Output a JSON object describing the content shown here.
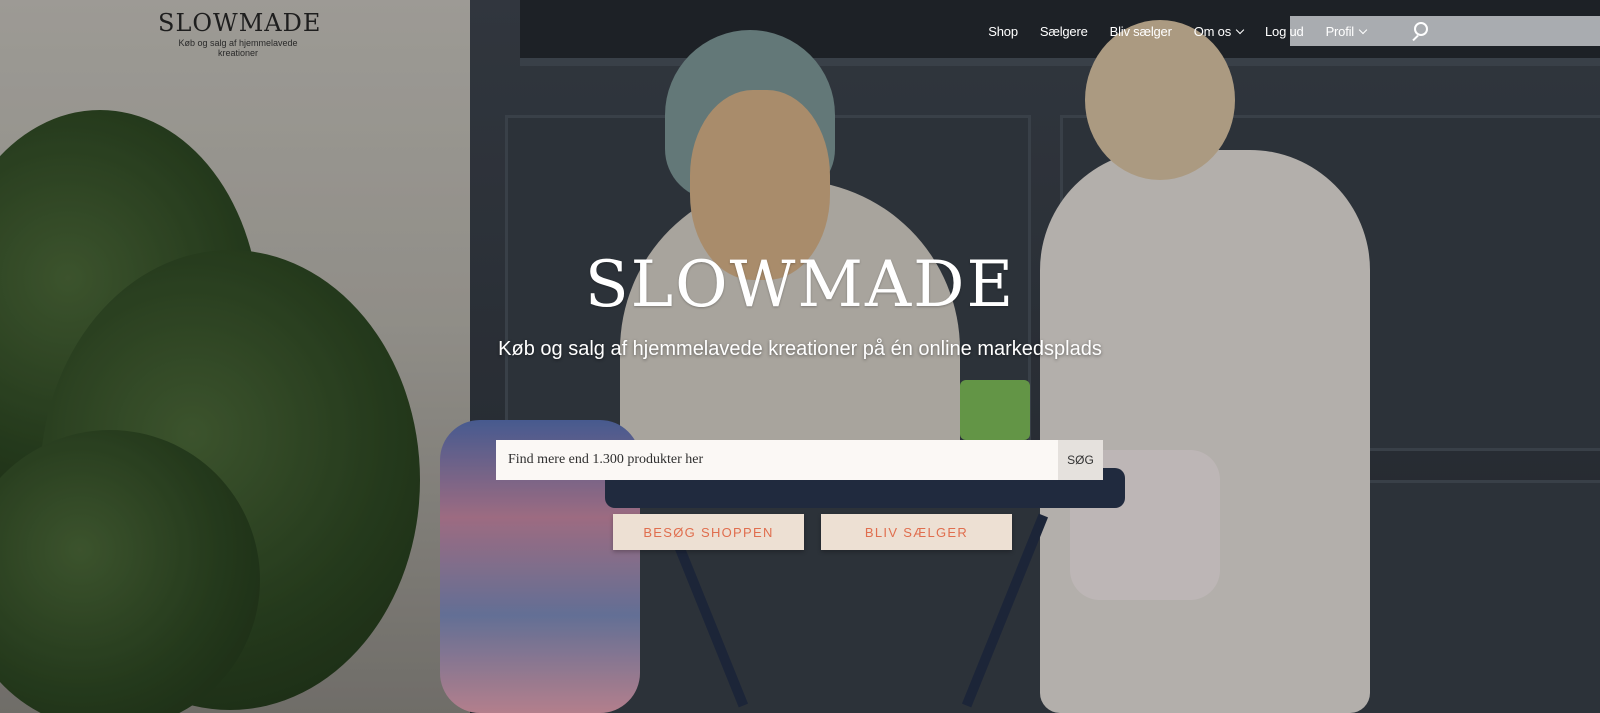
{
  "header": {
    "logo_word": "SLOWMADE",
    "logo_tagline": "Køb og salg af hjemmelavede kreationer",
    "nav": [
      {
        "label": "Shop",
        "dropdown": false
      },
      {
        "label": "Sælgere",
        "dropdown": false
      },
      {
        "label": "Bliv sælger",
        "dropdown": false
      },
      {
        "label": "Om os",
        "dropdown": true
      },
      {
        "label": "Log ud",
        "dropdown": false
      },
      {
        "label": "Profil",
        "dropdown": true
      }
    ],
    "search_icon": "search-icon"
  },
  "hero": {
    "title": "SLOWMADE",
    "subtitle": "Køb og salg af hjemmelavede kreationer på én online markedsplads",
    "search": {
      "placeholder": "Find mere end 1.300 produkter her",
      "value": "",
      "button_label": "SØG"
    },
    "cta_shop": "BESØG SHOPPEN",
    "cta_seller": "BLIV SÆLGER"
  },
  "colors": {
    "cta_bg": "#ede0d3",
    "cta_text": "#e06e4e",
    "search_bg": "#fbf8f5",
    "search_button_bg": "#e5e1dd"
  }
}
